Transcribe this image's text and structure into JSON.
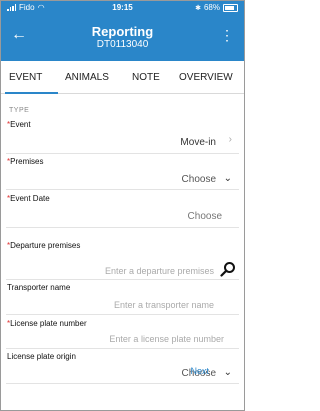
{
  "status_bar": {
    "carrier": "Fido",
    "time": "19:15",
    "battery": "68%",
    "bluetooth": "✱"
  },
  "app_bar": {
    "title": "Reporting",
    "subtitle": "DT0113040",
    "back_icon": "arrow-left-icon",
    "more_icon": "kebab-menu-icon"
  },
  "tabs": [
    {
      "label": "EVENT",
      "active": true
    },
    {
      "label": "ANIMALS"
    },
    {
      "label": "NOTE"
    },
    {
      "label": "OVERVIEW"
    }
  ],
  "form": {
    "section_label": "TYPE",
    "event": {
      "label": "Event",
      "value": "Move-in",
      "required": true
    },
    "premises": {
      "label": "Premises",
      "value": "Choose",
      "required": true
    },
    "event_date": {
      "label": "Event Date",
      "value": "Choose",
      "required": true
    },
    "departure_premises": {
      "label": "Departure premises",
      "placeholder": "Enter a departure premises",
      "required": true
    },
    "transporter_name": {
      "label": "Transporter name",
      "placeholder": "Enter a transporter name"
    },
    "license_plate_number": {
      "label": "License plate number",
      "placeholder": "Enter a license plate number",
      "required": true
    },
    "license_plate_origin": {
      "label": "License plate origin",
      "value": "Choose"
    }
  },
  "next_label": "Next",
  "colors": {
    "accent": "#2a86c9",
    "required": "#e03030"
  }
}
